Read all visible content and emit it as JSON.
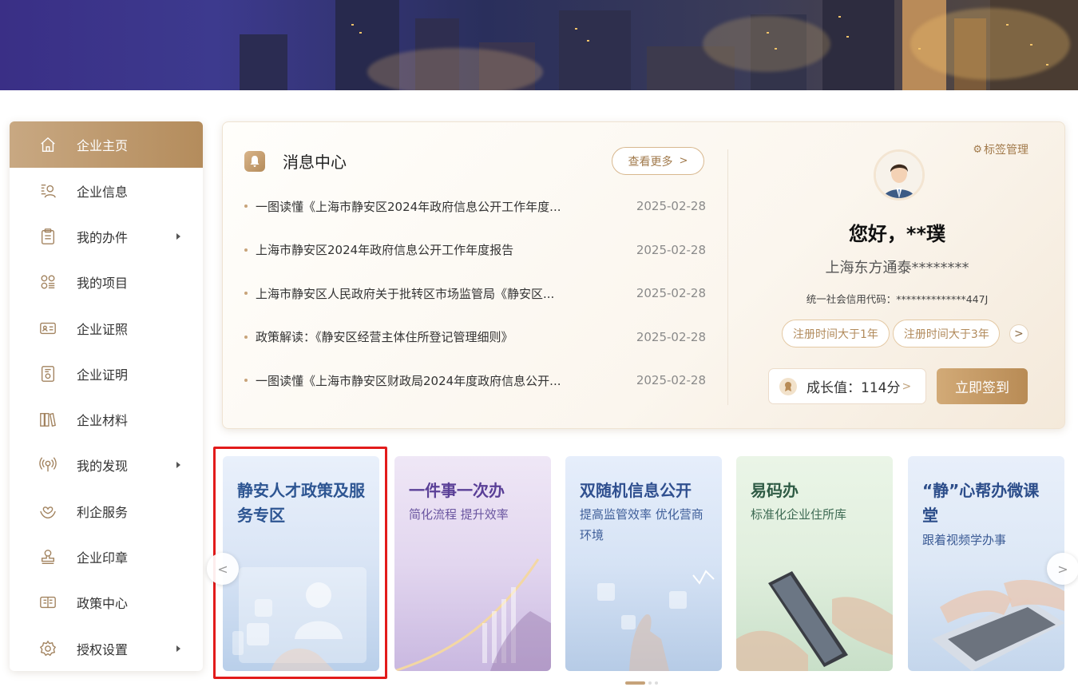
{
  "sidebar": {
    "items": [
      {
        "label": "企业主页",
        "icon": "home-icon",
        "active": true,
        "submenu": false
      },
      {
        "label": "企业信息",
        "icon": "enterprise-info-icon",
        "active": false,
        "submenu": false
      },
      {
        "label": "我的办件",
        "icon": "clipboard-icon",
        "active": false,
        "submenu": true
      },
      {
        "label": "我的项目",
        "icon": "project-grid-icon",
        "active": false,
        "submenu": false
      },
      {
        "label": "企业证照",
        "icon": "license-card-icon",
        "active": false,
        "submenu": false
      },
      {
        "label": "企业证明",
        "icon": "certificate-icon",
        "active": false,
        "submenu": false
      },
      {
        "label": "企业材料",
        "icon": "books-icon",
        "active": false,
        "submenu": false
      },
      {
        "label": "我的发现",
        "icon": "broadcast-icon",
        "active": false,
        "submenu": true
      },
      {
        "label": "利企服务",
        "icon": "heart-hands-icon",
        "active": false,
        "submenu": false
      },
      {
        "label": "企业印章",
        "icon": "stamp-icon",
        "active": false,
        "submenu": false
      },
      {
        "label": "政策中心",
        "icon": "policy-icon",
        "active": false,
        "submenu": false
      },
      {
        "label": "授权设置",
        "icon": "gear-icon",
        "active": false,
        "submenu": true
      }
    ]
  },
  "messages": {
    "title": "消息中心",
    "more_label": "查看更多",
    "items": [
      {
        "title": "一图读懂《上海市静安区2024年政府信息公开工作年度...",
        "date": "2025-02-28"
      },
      {
        "title": "上海市静安区2024年政府信息公开工作年度报告",
        "date": "2025-02-28"
      },
      {
        "title": "上海市静安区人民政府关于批转区市场监管局《静安区...",
        "date": "2025-02-28"
      },
      {
        "title": "政策解读：《静安区经营主体住所登记管理细则》",
        "date": "2025-02-28"
      },
      {
        "title": "一图读懂《上海市静安区财政局2024年度政府信息公开...",
        "date": "2025-02-28"
      }
    ]
  },
  "profile": {
    "tag_manage_label": "标签管理",
    "greeting": "您好，**璞",
    "company": "上海东方通泰********",
    "credit_code": "统一社会信用代码：**************447J",
    "tags": [
      "注册时间大于1年",
      "注册时间大于3年"
    ],
    "growth_label": "成长值：114分",
    "signin_label": "立即签到"
  },
  "cards": [
    {
      "title": "静安人才政策及服务专区",
      "subtitle": ""
    },
    {
      "title": "一件事一次办",
      "subtitle": "简化流程 提升效率"
    },
    {
      "title": "双随机信息公开",
      "subtitle": "提高监管效率 优化营商环境"
    },
    {
      "title": "易码办",
      "subtitle": "标准化企业住所库"
    },
    {
      "title": "“静”心帮办微课堂",
      "subtitle": "跟着视频学办事"
    }
  ],
  "colors": {
    "accent": "#b48c5c",
    "highlight": "#e21b1b"
  }
}
